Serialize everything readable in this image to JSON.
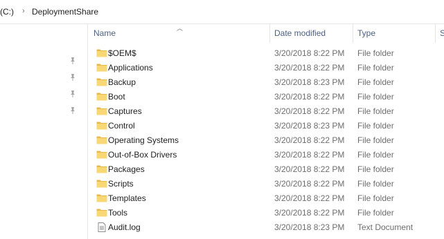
{
  "address": {
    "drive_label": "(C:)",
    "folder_label": "DeploymentShare"
  },
  "columns": {
    "name": "Name",
    "date": "Date modified",
    "type": "Type",
    "size": "S"
  },
  "rows": [
    {
      "name": "$OEM$",
      "date": "3/20/2018 8:22 PM",
      "type": "File folder",
      "icon": "folder-icon"
    },
    {
      "name": "Applications",
      "date": "3/20/2018 8:22 PM",
      "type": "File folder",
      "icon": "folder-icon"
    },
    {
      "name": "Backup",
      "date": "3/20/2018 8:23 PM",
      "type": "File folder",
      "icon": "folder-icon"
    },
    {
      "name": "Boot",
      "date": "3/20/2018 8:22 PM",
      "type": "File folder",
      "icon": "folder-icon"
    },
    {
      "name": "Captures",
      "date": "3/20/2018 8:22 PM",
      "type": "File folder",
      "icon": "folder-icon"
    },
    {
      "name": "Control",
      "date": "3/20/2018 8:23 PM",
      "type": "File folder",
      "icon": "folder-icon"
    },
    {
      "name": "Operating Systems",
      "date": "3/20/2018 8:22 PM",
      "type": "File folder",
      "icon": "folder-icon"
    },
    {
      "name": "Out-of-Box Drivers",
      "date": "3/20/2018 8:22 PM",
      "type": "File folder",
      "icon": "folder-icon"
    },
    {
      "name": "Packages",
      "date": "3/20/2018 8:22 PM",
      "type": "File folder",
      "icon": "folder-icon"
    },
    {
      "name": "Scripts",
      "date": "3/20/2018 8:22 PM",
      "type": "File folder",
      "icon": "folder-icon"
    },
    {
      "name": "Templates",
      "date": "3/20/2018 8:22 PM",
      "type": "File folder",
      "icon": "folder-icon"
    },
    {
      "name": "Tools",
      "date": "3/20/2018 8:22 PM",
      "type": "File folder",
      "icon": "folder-icon"
    },
    {
      "name": "Audit.log",
      "date": "3/20/2018 8:23 PM",
      "type": "Text Document",
      "icon": "text-file-icon"
    }
  ],
  "colors": {
    "header_text": "#4d6082",
    "folder_fill": "#f8d775",
    "folder_back": "#e8b84a",
    "secondary_text": "#6d6d6d"
  }
}
